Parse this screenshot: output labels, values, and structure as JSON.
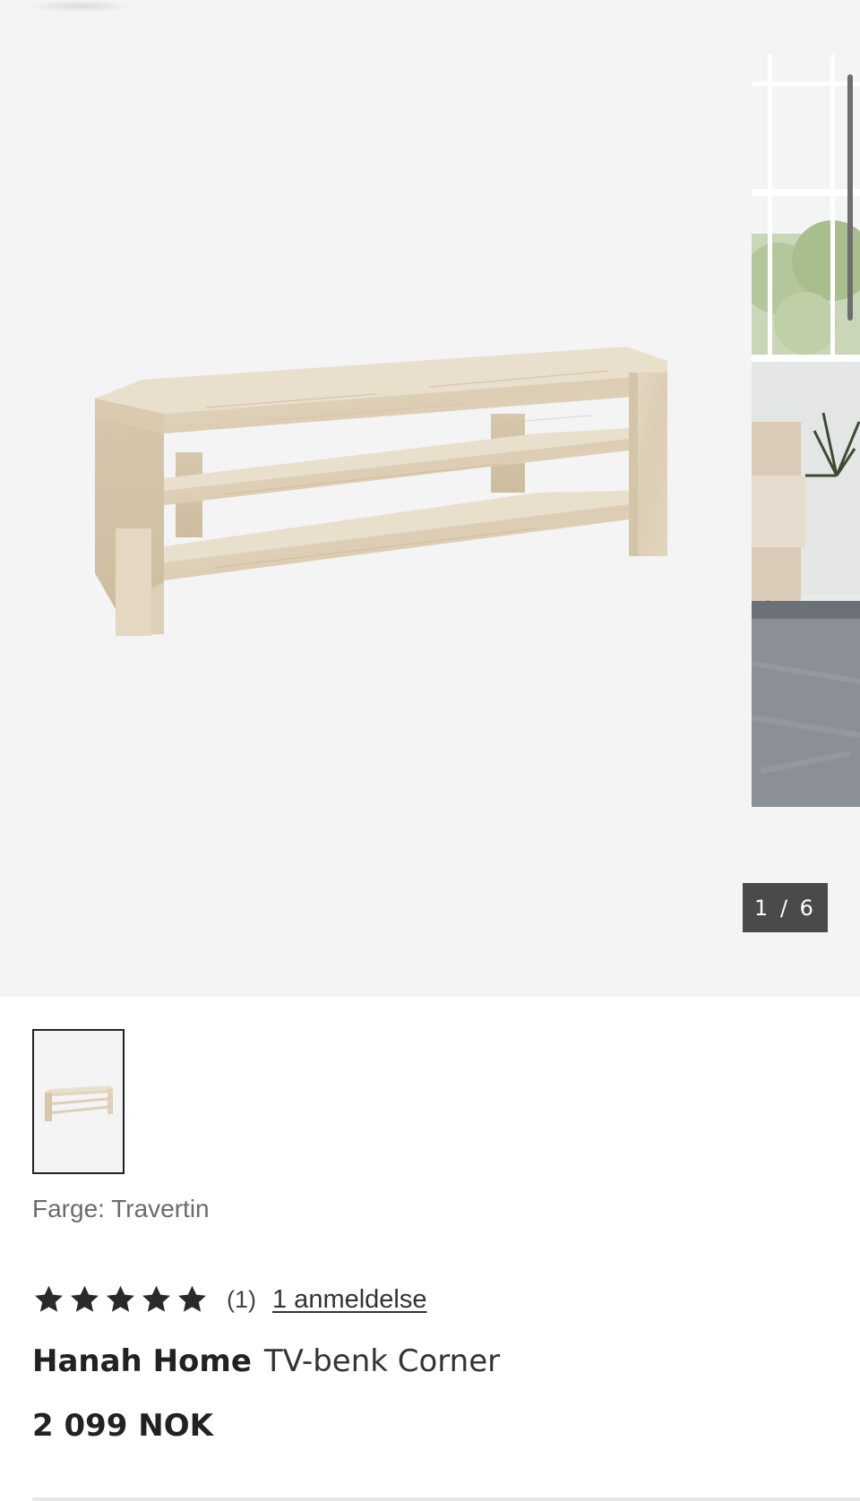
{
  "gallery": {
    "counter": "1 / 6",
    "current_image": 1,
    "total_images": 6,
    "main_image_icon": "tv-bench-image",
    "next_image_icon": "living-room-photo"
  },
  "product": {
    "color_line": "Farge: Travertin",
    "rating": 5,
    "rating_max": 5,
    "rating_count": "(1)",
    "reviews_link": "1 anmeldelse",
    "brand": "Hanah Home",
    "name": "TV-benk Corner",
    "price": "2 099 NOK"
  },
  "colors": {
    "gallery_bg": "#f4f4f4",
    "counter_bg": "#4a4a4a",
    "star": "#2a2a2a",
    "travertine": "#e3d6c1"
  }
}
